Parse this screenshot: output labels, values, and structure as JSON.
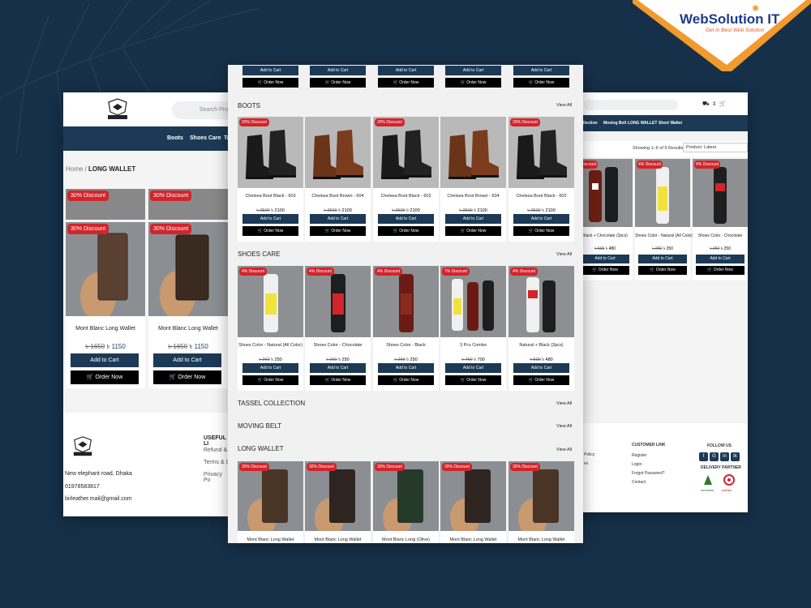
{
  "brand": {
    "name": "WebSolution IT",
    "tagline": "Get in Best Web Solution"
  },
  "colors": {
    "background": "#163049",
    "navbar": "#1c3a55",
    "discount": "#d2242b",
    "order": "#000000"
  },
  "left_page": {
    "search_placeholder": "Search Pro",
    "nav": [
      "Boots",
      "Shoes Care",
      "Ta"
    ],
    "breadcrumb": {
      "home": "Home",
      "sep": "/",
      "current": "LONG WALLET"
    },
    "products": [
      {
        "discount": "30% Discount",
        "title": "Mont Blanc Long Wallet",
        "old_price": "৳ 1650",
        "price": "৳ 1150",
        "add": "Add to Cart",
        "order": "Order Now"
      },
      {
        "discount": "30% Discount",
        "title": "Mont Blanc Long Wallet",
        "old_price": "৳ 1650",
        "price": "৳ 1150",
        "add": "Add to Cart",
        "order": "Order Now"
      }
    ],
    "top_discounts": [
      "30% Discount",
      "30% Discount"
    ],
    "footer": {
      "address": "New elephant road, Dhaka",
      "phone": "01978583817",
      "email": "birleather.mail@gmail.com",
      "useful_heading": "USEFUL LI",
      "useful_links": [
        "Refund &",
        "Terms & C",
        "Privacy Po"
      ]
    }
  },
  "center_page": {
    "top_buttons": {
      "add": "Add to Cart",
      "order": "Order Now"
    },
    "view_all": "View All",
    "sections": [
      {
        "title": "BOOTS",
        "products": [
          {
            "discount": "20% Discount",
            "title": "Chelsea Boot Black - 603",
            "old_price": "৳ 2500",
            "price": "৳ 2100"
          },
          {
            "discount": "",
            "title": "Chelsea Boot Brown - 604",
            "old_price": "৳ 2500",
            "price": "৳ 2100"
          },
          {
            "discount": "20% Discount",
            "title": "Chelsea Boot Black - 602",
            "old_price": "৳ 2500",
            "price": "৳ 2100"
          },
          {
            "discount": "",
            "title": "Chelsea Boot Brown - 604",
            "old_price": "৳ 2500",
            "price": "৳ 2100"
          },
          {
            "discount": "20% Discount",
            "title": "Chelsea Boot Black - 602",
            "old_price": "৳ 2500",
            "price": "৳ 2100"
          }
        ]
      },
      {
        "title": "SHOES CARE",
        "products": [
          {
            "discount": "4% Discount",
            "title": "Shoes Color - Natural (All Color)",
            "old_price": "৳ 260",
            "price": "৳ 250"
          },
          {
            "discount": "4% Discount",
            "title": "Shoes Color - Chocolate",
            "old_price": "৳ 260",
            "price": "৳ 250"
          },
          {
            "discount": "4% Discount",
            "title": "Shoes Color - Black",
            "old_price": "৳ 260",
            "price": "৳ 250"
          },
          {
            "discount": "7% Discount",
            "title": "3 Pcs Combo",
            "old_price": "৳ 750",
            "price": "৳ 700"
          },
          {
            "discount": "4% Discount",
            "title": "Natural + Black (2pcs)",
            "old_price": "৳ 500",
            "price": "৳ 480"
          }
        ]
      }
    ],
    "tassel_title": "TASSEL COLLECTION",
    "moving_title": "MOVING BELT",
    "wallet_title": "LONG WALLET",
    "wallets": [
      {
        "discount": "30% Discount",
        "title": "Mont Blanc Long Wallet"
      },
      {
        "discount": "30% Discount",
        "title": "Mont Blanc Long Wallet"
      },
      {
        "discount": "30% Discount",
        "title": "Mont Blanc Long (Olive)"
      },
      {
        "discount": "30% Discount",
        "title": "Mont Blanc Long Wallet"
      },
      {
        "discount": "30% Discount",
        "title": "Mont Blanc Long Wallet"
      }
    ],
    "add": "Add to Cart",
    "order": "Order Now"
  },
  "right_page": {
    "nav": [
      "ollection",
      "Moving Belt",
      "LONG WALLET",
      "Short Wallet"
    ],
    "results": "Showing 1–6 of 6 Results",
    "sort": "Product: Latest",
    "products": [
      {
        "discount": "Discount",
        "title": "Black + Chocolate (2pcs)",
        "old_price": "৳ 500",
        "price": "৳ 480"
      },
      {
        "discount": "4% Discount",
        "title": "Shoes Color - Natural (All Color)",
        "old_price": "৳ 260",
        "price": "৳ 250"
      },
      {
        "discount": "4% Discount",
        "title": "Shoes Color - Chocolate",
        "old_price": "৳ 260",
        "price": "৳ 250"
      }
    ],
    "add": "Add to Cart",
    "order": "Order Now",
    "footer": {
      "policy": [
        "Policy",
        "es"
      ],
      "customer_heading": "CUSTOMER LINK",
      "customer_links": [
        "Register",
        "Login",
        "Forgot Password?",
        "Contact"
      ],
      "follow": "FOLLOW US",
      "delivery": "DELIVERY PARTNER",
      "social": [
        "f",
        "G",
        "in",
        "tk"
      ],
      "partners": [
        "steadfast",
        "pathao"
      ]
    }
  }
}
